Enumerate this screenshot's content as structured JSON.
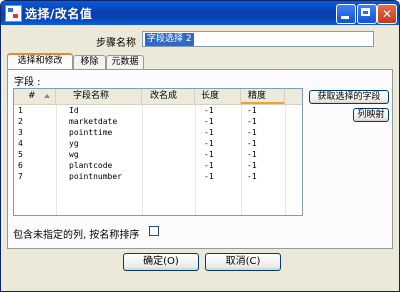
{
  "window": {
    "title": "选择/改名值"
  },
  "step": {
    "label": "步骤名称",
    "value": "字段选择 2"
  },
  "tabs": [
    {
      "label": "选择和修改",
      "active": true
    },
    {
      "label": "移除",
      "active": false
    },
    {
      "label": "元数据",
      "active": false
    }
  ],
  "fields": {
    "label": "字段 :",
    "columns": {
      "num": "#",
      "name": "字段名称",
      "rename": "改名成",
      "length": "长度",
      "precision": "精度"
    },
    "rows": [
      {
        "n": "1",
        "name": "Id",
        "rename": "",
        "length": "-1",
        "precision": "-1"
      },
      {
        "n": "2",
        "name": "marketdate",
        "rename": "",
        "length": "-1",
        "precision": "-1"
      },
      {
        "n": "3",
        "name": "pointtime",
        "rename": "",
        "length": "-1",
        "precision": "-1"
      },
      {
        "n": "4",
        "name": "yg",
        "rename": "",
        "length": "-1",
        "precision": "-1"
      },
      {
        "n": "5",
        "name": "wg",
        "rename": "",
        "length": "-1",
        "precision": "-1"
      },
      {
        "n": "6",
        "name": "plantcode",
        "rename": "",
        "length": "-1",
        "precision": "-1"
      },
      {
        "n": "7",
        "name": "pointnumber",
        "rename": "",
        "length": "-1",
        "precision": "-1"
      }
    ]
  },
  "buttons": {
    "get_fields": "获取选择的字段",
    "column_mapping": "列映射",
    "ok": "确定(O)",
    "cancel": "取消(C)"
  },
  "options": {
    "include_unspecified_label": "包含未指定的列, 按名称排序",
    "include_unspecified_checked": false
  },
  "colors": {
    "title_bar": "#0a3fb3",
    "selection": "#316ac5",
    "tab_accent": "#e68b2c"
  }
}
